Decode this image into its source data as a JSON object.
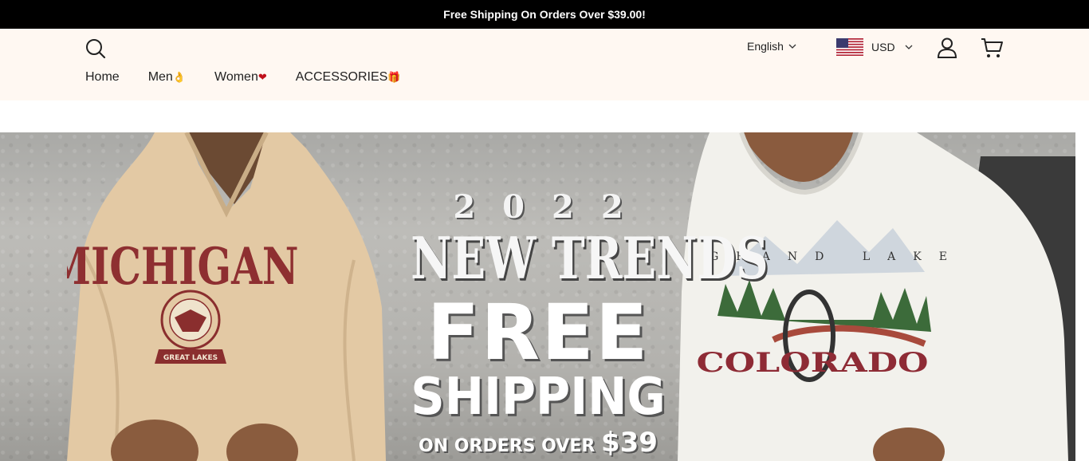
{
  "announcement": {
    "text": "Free Shipping On Orders Over $39.00!"
  },
  "header": {
    "search_icon": "search-icon",
    "nav": [
      {
        "label": "Home",
        "emoji": ""
      },
      {
        "label": "Men",
        "emoji": "👌"
      },
      {
        "label": "Women",
        "emoji": "❤"
      },
      {
        "label": "ACCESSORIES",
        "emoji": "🎁"
      }
    ],
    "language": {
      "selected": "English"
    },
    "currency": {
      "selected": "USD",
      "flag_icon": "us-flag-icon"
    },
    "account_icon": "user-icon",
    "cart_icon": "cart-icon"
  },
  "hero": {
    "year": "2022",
    "headline": "NEW TRENDS",
    "free": "FREE",
    "shipping": "SHIPPING",
    "orders_text": "ON ORDERS OVER",
    "orders_amount": "$39",
    "left_hoodie": {
      "main": "MICHIGAN",
      "badge": "GREAT LAKES",
      "color": "#e3c9a4"
    },
    "right_hoodie": {
      "top": "GRAND LAKE",
      "main": "COLORADO",
      "color": "#f2f1ec"
    }
  },
  "colors": {
    "announcement_bg": "#000000",
    "header_bg": "#fff8f2",
    "text": "#222222"
  }
}
